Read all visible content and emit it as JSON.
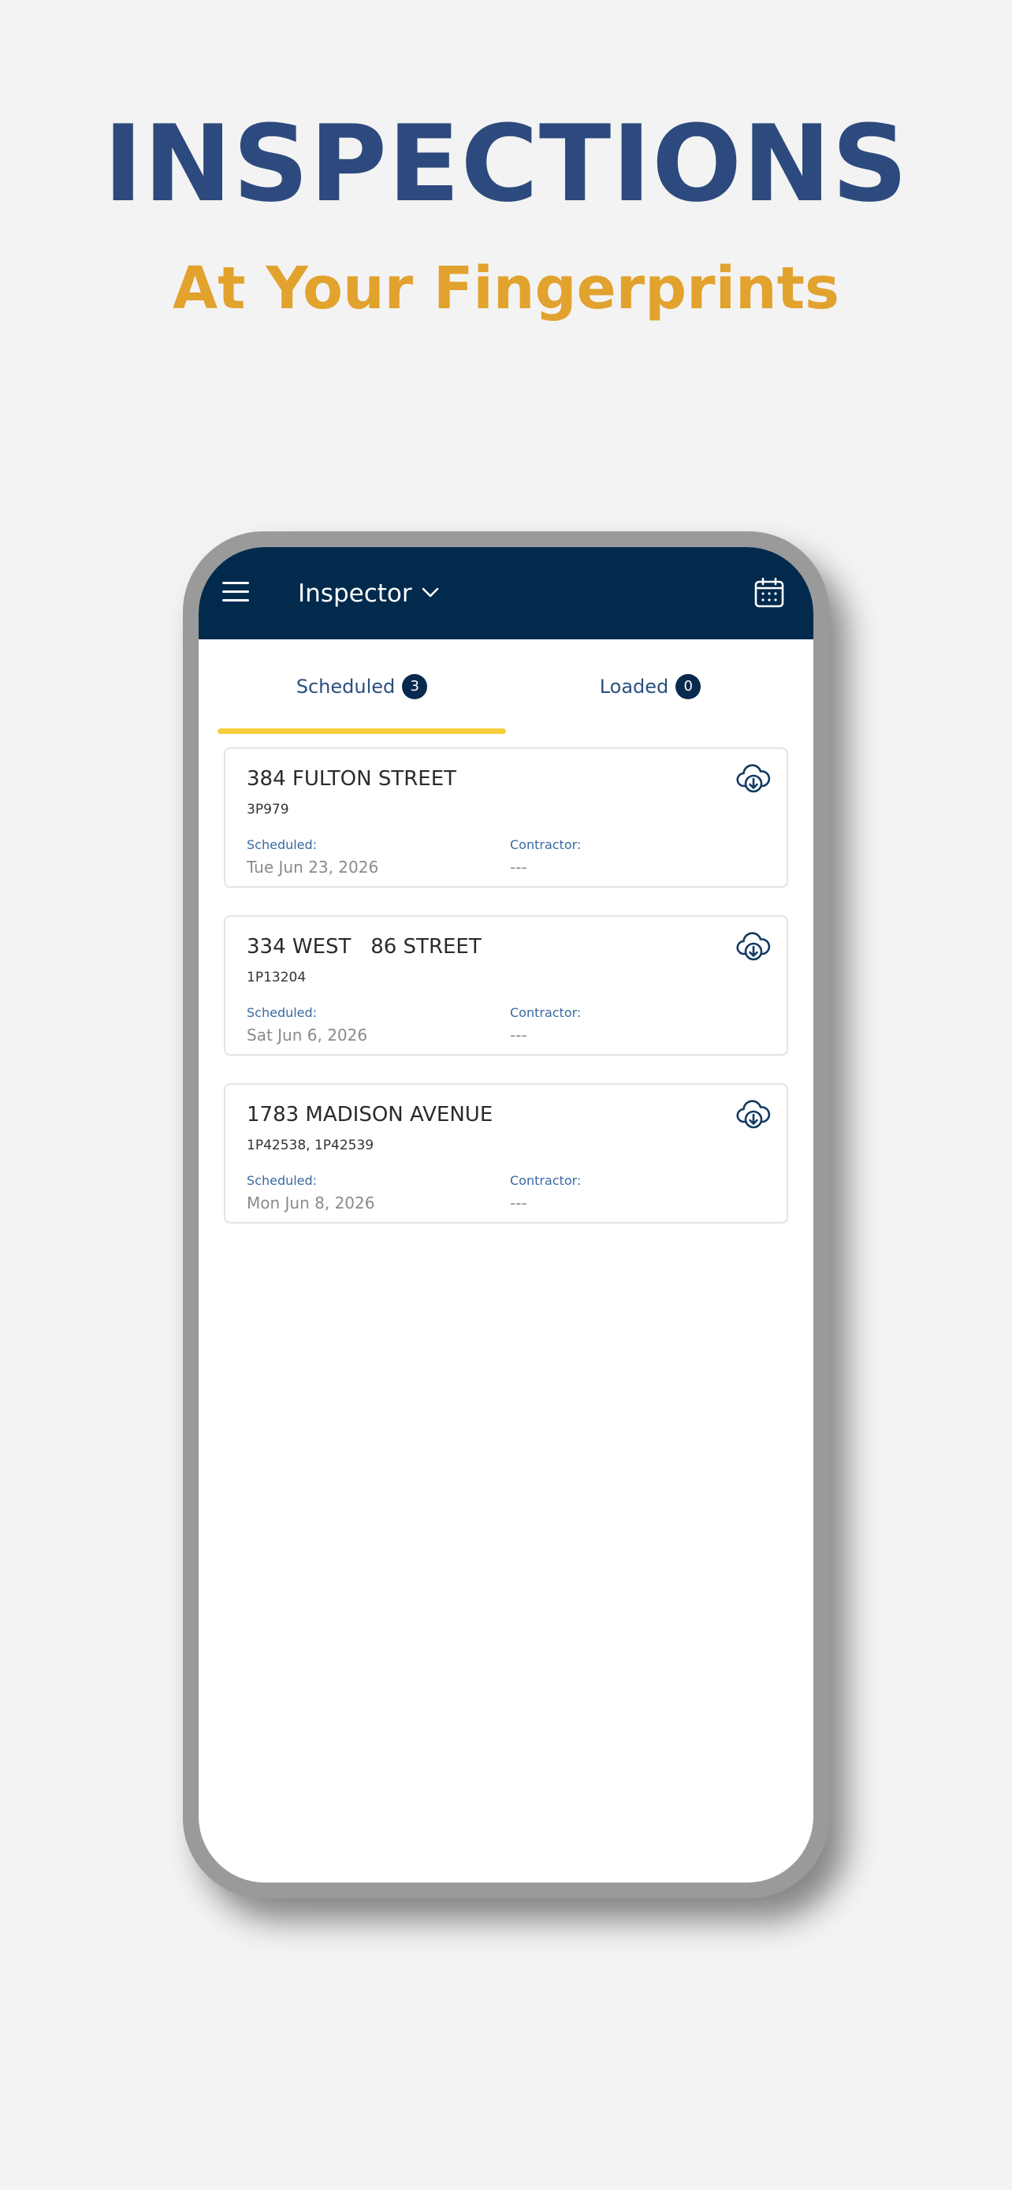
{
  "hero": {
    "title": "INSPECTIONS",
    "subtitle": "At Your Fingerprints"
  },
  "appbar": {
    "title": "Inspector",
    "menu_icon": "hamburger-menu-icon",
    "dropdown_icon": "chevron-down-icon",
    "calendar_icon": "calendar-icon"
  },
  "tabs": [
    {
      "label": "Scheduled",
      "count": "3",
      "active": true
    },
    {
      "label": "Loaded",
      "count": "0",
      "active": false
    }
  ],
  "cards": [
    {
      "address": "384 FULTON STREET",
      "ids": "3P979",
      "scheduled_label": "Scheduled:",
      "scheduled_value": "Tue Jun 23, 2026",
      "contractor_label": "Contractor:",
      "contractor_value": "---"
    },
    {
      "address": "334 WEST   86 STREET",
      "ids": "1P13204",
      "scheduled_label": "Scheduled:",
      "scheduled_value": "Sat Jun 6, 2026",
      "contractor_label": "Contractor:",
      "contractor_value": "---"
    },
    {
      "address": "1783 MADISON AVENUE",
      "ids": "1P42538, 1P42539",
      "scheduled_label": "Scheduled:",
      "scheduled_value": "Mon Jun 8, 2026",
      "contractor_label": "Contractor:",
      "contractor_value": "---"
    }
  ],
  "colors": {
    "title_blue": "#2d4a7e",
    "subtitle_gold": "#e2a22e",
    "appbar_navy": "#022a4d",
    "tab_indicator_yellow": "#f6cd3c"
  }
}
